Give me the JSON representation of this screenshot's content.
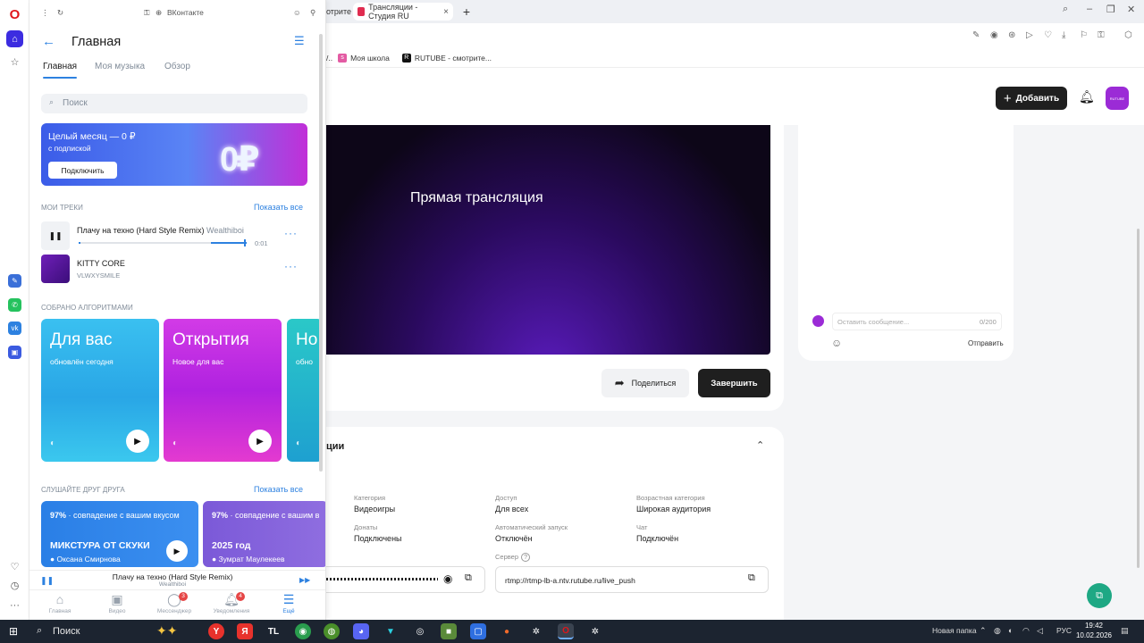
{
  "browser": {
    "tab_prev_label": "отрите",
    "tab_active_label": "Трансляции - Студия RU",
    "tab_close": "×",
    "tab_new": "+",
    "bookmarks": [
      {
        "label": "Моя школа",
        "icon": "school-icon",
        "color": "#e35ba3"
      },
      {
        "label": "RUTUBE - смотрите...",
        "icon": "rutube-icon",
        "color": "#111111"
      }
    ]
  },
  "studio": {
    "add_button": "Добавить",
    "avatar_text": "RUTUBE",
    "preview_title": "Прямая трансляция",
    "share_button": "Поделиться",
    "end_button": "Завершить",
    "chat_placeholder": "Оставить сообщение...",
    "chat_counter": "0/200",
    "chat_send": "Отправить",
    "info_section_title": "ции",
    "info": [
      {
        "label": "Категория",
        "value": "Видеоигры"
      },
      {
        "label": "Доступ",
        "value": "Для всех"
      },
      {
        "label": "Возрастная категория",
        "value": "Широкая аудитория"
      },
      {
        "label": "Донаты",
        "value": "Подключены"
      },
      {
        "label": "Автоматический запуск",
        "value": "Отключён"
      },
      {
        "label": "Чат",
        "value": "Подключён"
      }
    ],
    "server_label": "Сервер",
    "server_value": "rtmp://rtmp-lb-a.ntv.rutube.ru/live_push",
    "accent_color": "#1f1f1f"
  },
  "vk": {
    "topbar_title": "ВКонтакте",
    "header_title": "Главная",
    "tabs": [
      "Главная",
      "Моя музыка",
      "Обзор"
    ],
    "search_placeholder": "Поиск",
    "promo": {
      "title": "Целый месяц — 0 ₽",
      "subtitle": "с подпиской",
      "button": "Подключить"
    },
    "my_tracks_title": "Мои треки",
    "show_all": "Показать все",
    "tracks": [
      {
        "title": "Плачу на техно (Hard Style Remix)",
        "artist": "Wealthiboi",
        "time": "0:01",
        "state": "playing"
      },
      {
        "title": "KITTY CORE",
        "artist": "VLWXYSMILE"
      }
    ],
    "algo_title": "Собрано алгоритмами",
    "algo_cards": [
      {
        "title": "Для вас",
        "subtitle": "обновлён сегодня"
      },
      {
        "title": "Открытия",
        "subtitle": "Новое для вас"
      },
      {
        "title": "Но",
        "subtitle": "обно"
      }
    ],
    "friends_title": "Слушайте друг друга",
    "mixes": [
      {
        "pct": "97%",
        "pct_text": " · совпадение с вашим вкусом",
        "title": "МИКСТУРА ОТ СКУКИ",
        "author": "Оксана Смирнова"
      },
      {
        "pct": "97%",
        "pct_text": " · совпадение с вашим в",
        "title": "2025 год",
        "author": "Зумрат Маулекеев"
      }
    ],
    "mini_player": {
      "title": "Плачу на техно (Hard Style Remix)",
      "artist": "Wealthiboi"
    },
    "nav": [
      {
        "label": "Главная",
        "icon": "home-icon"
      },
      {
        "label": "Видео",
        "icon": "video-icon"
      },
      {
        "label": "Мессенджер",
        "icon": "messenger-icon",
        "badge": "3"
      },
      {
        "label": "Уведомления",
        "icon": "bell-icon",
        "badge": "4"
      },
      {
        "label": "Ещё",
        "icon": "menu-icon"
      }
    ],
    "accent_color": "#2d81e0"
  },
  "taskbar": {
    "search_placeholder": "Поиск",
    "notification": "Новая папка",
    "lang": "РУС",
    "time": "19:42",
    "date": "10.02.2026"
  }
}
